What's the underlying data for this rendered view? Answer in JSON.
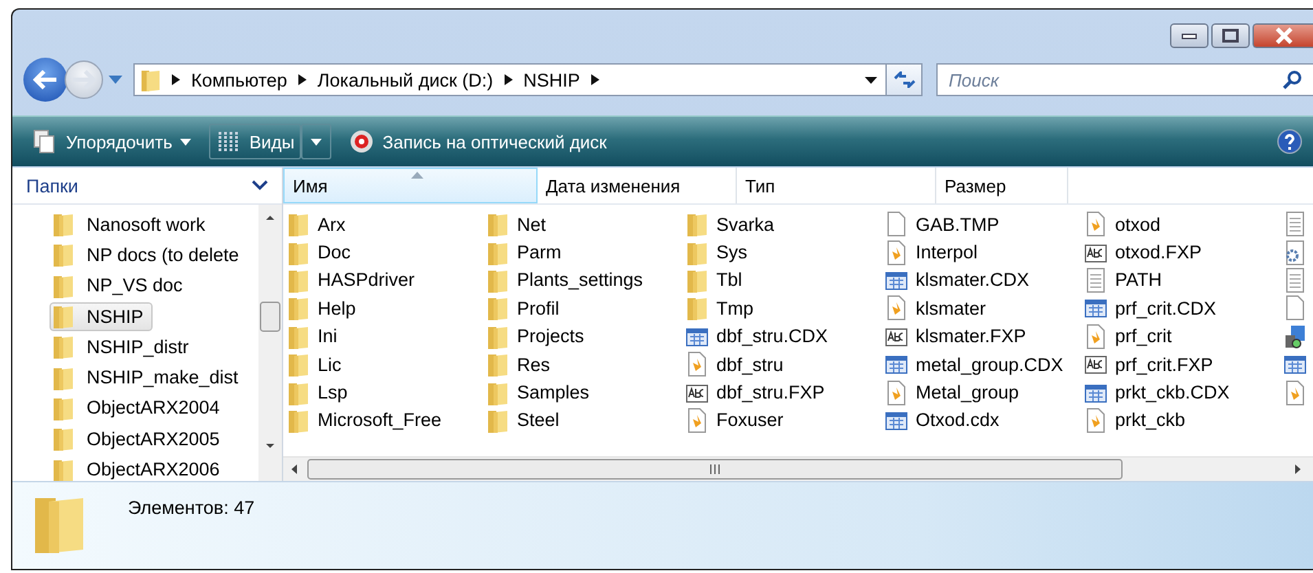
{
  "window": {
    "buttons": [
      {
        "kind": "minimize"
      },
      {
        "kind": "maximize"
      },
      {
        "kind": "close"
      }
    ]
  },
  "address": {
    "path": [
      "Компьютер",
      "Локальный диск (D:)",
      "NSHIP"
    ]
  },
  "search": {
    "placeholder": "Поиск"
  },
  "toolbar": {
    "organize": "Упорядочить",
    "views": "Виды",
    "burn": "Запись на оптический диск"
  },
  "sidebar": {
    "title": "Папки",
    "items": [
      {
        "label": "Nanosoft work",
        "selected": false
      },
      {
        "label": "NP docs (to delete",
        "selected": false
      },
      {
        "label": "NP_VS doc",
        "selected": false
      },
      {
        "label": "NSHIP",
        "selected": true
      },
      {
        "label": "NSHIP_distr",
        "selected": false
      },
      {
        "label": "NSHIP_make_dist",
        "selected": false
      },
      {
        "label": "ObjectARX2004",
        "selected": false
      },
      {
        "label": "ObjectARX2005",
        "selected": false
      },
      {
        "label": "ObjectARX2006",
        "selected": false
      }
    ]
  },
  "columns": [
    {
      "label": "Имя",
      "sorted": true
    },
    {
      "label": "Дата изменения",
      "sorted": false
    },
    {
      "label": "Тип",
      "sorted": false
    },
    {
      "label": "Размер",
      "sorted": false
    }
  ],
  "files": [
    {
      "name": "Arx",
      "kind": "folder"
    },
    {
      "name": "Doc",
      "kind": "folder"
    },
    {
      "name": "HASPdriver",
      "kind": "folder"
    },
    {
      "name": "Help",
      "kind": "folder"
    },
    {
      "name": "Ini",
      "kind": "folder"
    },
    {
      "name": "Lic",
      "kind": "folder"
    },
    {
      "name": "Lsp",
      "kind": "folder"
    },
    {
      "name": "Microsoft_Free",
      "kind": "folder"
    },
    {
      "name": "Net",
      "kind": "folder"
    },
    {
      "name": "Parm",
      "kind": "folder"
    },
    {
      "name": "Plants_settings",
      "kind": "folder"
    },
    {
      "name": "Profil",
      "kind": "folder"
    },
    {
      "name": "Projects",
      "kind": "folder"
    },
    {
      "name": "Res",
      "kind": "folder"
    },
    {
      "name": "Samples",
      "kind": "folder"
    },
    {
      "name": "Steel",
      "kind": "folder"
    },
    {
      "name": "Svarka",
      "kind": "folder"
    },
    {
      "name": "Sys",
      "kind": "folder"
    },
    {
      "name": "Tbl",
      "kind": "folder"
    },
    {
      "name": "Tmp",
      "kind": "folder"
    },
    {
      "name": "dbf_stru.CDX",
      "kind": "index"
    },
    {
      "name": "dbf_stru",
      "kind": "program"
    },
    {
      "name": "dbf_stru.FXP",
      "kind": "compiled"
    },
    {
      "name": "Foxuser",
      "kind": "program"
    },
    {
      "name": "GAB.TMP",
      "kind": "blank"
    },
    {
      "name": "Interpol",
      "kind": "program"
    },
    {
      "name": "klsmater.CDX",
      "kind": "index"
    },
    {
      "name": "klsmater",
      "kind": "program"
    },
    {
      "name": "klsmater.FXP",
      "kind": "compiled"
    },
    {
      "name": "metal_group.CDX",
      "kind": "index"
    },
    {
      "name": "Metal_group",
      "kind": "program"
    },
    {
      "name": "Otxod.cdx",
      "kind": "index"
    },
    {
      "name": "otxod",
      "kind": "program"
    },
    {
      "name": "otxod.FXP",
      "kind": "compiled"
    },
    {
      "name": "PATH",
      "kind": "text"
    },
    {
      "name": "prf_crit.CDX",
      "kind": "index"
    },
    {
      "name": "prf_crit",
      "kind": "program"
    },
    {
      "name": "prf_crit.FXP",
      "kind": "compiled"
    },
    {
      "name": "prkt_ckb.CDX",
      "kind": "index"
    },
    {
      "name": "prkt_ckb",
      "kind": "program"
    },
    {
      "kind": "text"
    },
    {
      "kind": "config"
    },
    {
      "kind": "text"
    },
    {
      "kind": "blank"
    },
    {
      "kind": "setup"
    },
    {
      "kind": "index"
    },
    {
      "kind": "program"
    }
  ],
  "status": {
    "text": "Элементов: 47"
  }
}
